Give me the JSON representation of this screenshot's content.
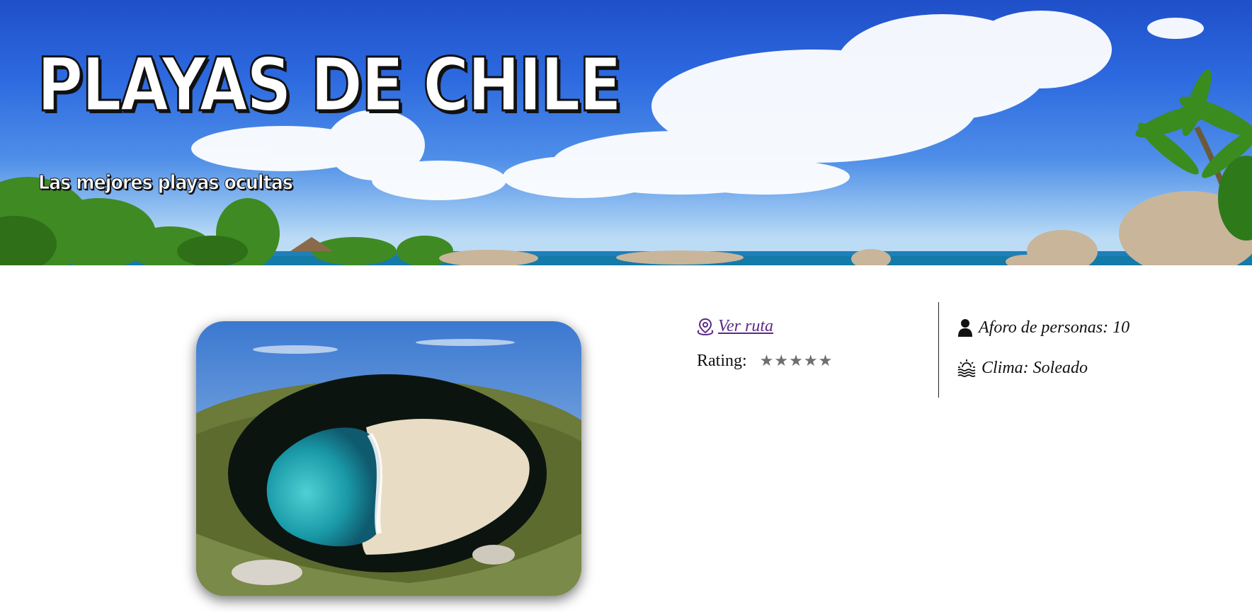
{
  "banner": {
    "title": "PLAYAS DE CHILE",
    "subtitle": "Las mejores playas ocultas"
  },
  "beach": {
    "route_label": "Ver ruta",
    "rating_label": "Rating:",
    "rating_stars": "★★★★★",
    "rating_value": 0,
    "capacity_label": "Aforo de personas: 10",
    "weather_label": "Clima: Soleado"
  },
  "icons": {
    "route": "map-pin-icon",
    "capacity": "person-icon",
    "weather": "sunset-waves-icon"
  },
  "colors": {
    "link": "#5b2a86",
    "stars": "#6f6f6f",
    "sky": "#2d6ae0"
  }
}
